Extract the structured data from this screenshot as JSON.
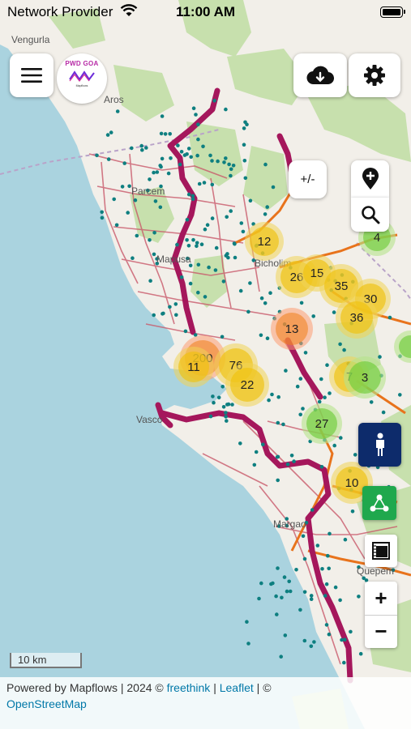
{
  "status_bar": {
    "carrier": "Network Provider",
    "time": "11:00 AM"
  },
  "logo": {
    "text": "PWD GOA",
    "subtext": "Mapflows"
  },
  "map": {
    "place_labels": [
      "Vengurla",
      "Aros",
      "Parcem",
      "Mapusa",
      "Bicholim",
      "Vasco",
      "Margao",
      "Quepem"
    ],
    "clusters": [
      {
        "label": "12",
        "color": "yellow"
      },
      {
        "label": "26",
        "color": "yellow"
      },
      {
        "label": "15",
        "color": "yellow"
      },
      {
        "label": "35",
        "color": "yellow"
      },
      {
        "label": "30",
        "color": "yellow"
      },
      {
        "label": "36",
        "color": "yellow"
      },
      {
        "label": "13",
        "color": "orange"
      },
      {
        "label": "200",
        "color": "orange"
      },
      {
        "label": "11",
        "color": "yellow"
      },
      {
        "label": "76",
        "color": "yellow"
      },
      {
        "label": "22",
        "color": "yellow"
      },
      {
        "label": "7",
        "color": "yellow"
      },
      {
        "label": "3",
        "color": "green"
      },
      {
        "label": "27",
        "color": "green"
      },
      {
        "label": "10",
        "color": "yellow"
      },
      {
        "label": "4",
        "color": "green"
      }
    ],
    "scale_label": "10 km"
  },
  "controls": {
    "toggle_label": "+/-",
    "zoom_in": "+",
    "zoom_out": "−"
  },
  "attribution": {
    "prefix": "Powered by Mapflows | 2024 © ",
    "link1": "freethink",
    "sep1": " | ",
    "link2": "Leaflet",
    "sep2": " | © ",
    "link3": "OpenStreetMap"
  },
  "colors": {
    "highway": "#a5175c",
    "primary": "#e8731c",
    "secondary": "#c95a6b",
    "pin": "#0e7f80",
    "person_button": "#0d2b6b",
    "network_button": "#1fa84d"
  }
}
